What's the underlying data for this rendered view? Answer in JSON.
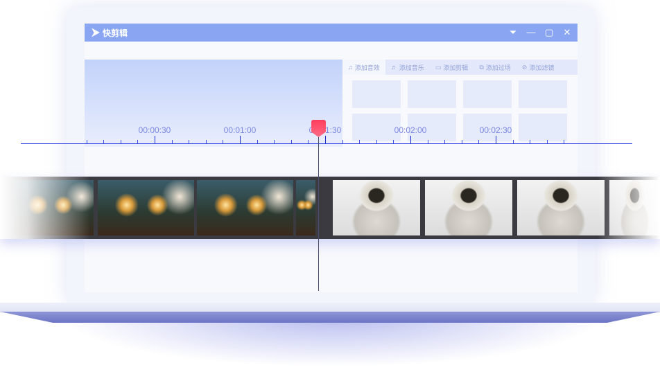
{
  "app": {
    "title": "快剪辑"
  },
  "window_controls": [
    "dropdown-icon",
    "minimize-icon",
    "maximize-icon",
    "close-icon"
  ],
  "tabs": [
    {
      "label": "添加音效",
      "icon": "sound-effect-icon"
    },
    {
      "label": "添加音乐",
      "icon": "music-icon"
    },
    {
      "label": "添加剪辑",
      "icon": "video-clip-icon"
    },
    {
      "label": "添加过场",
      "icon": "transition-icon"
    },
    {
      "label": "添加滤镜",
      "icon": "filter-icon"
    }
  ],
  "timeline": {
    "labels": [
      "00:00:30",
      "00:01:00",
      "00:01:30",
      "00:02:00",
      "00:02:30"
    ],
    "playhead": "00:01:30"
  },
  "colors": {
    "titlebar": "#8aa6f3",
    "playhead": "#ff3d5e",
    "ruler": "#2b3be6"
  }
}
